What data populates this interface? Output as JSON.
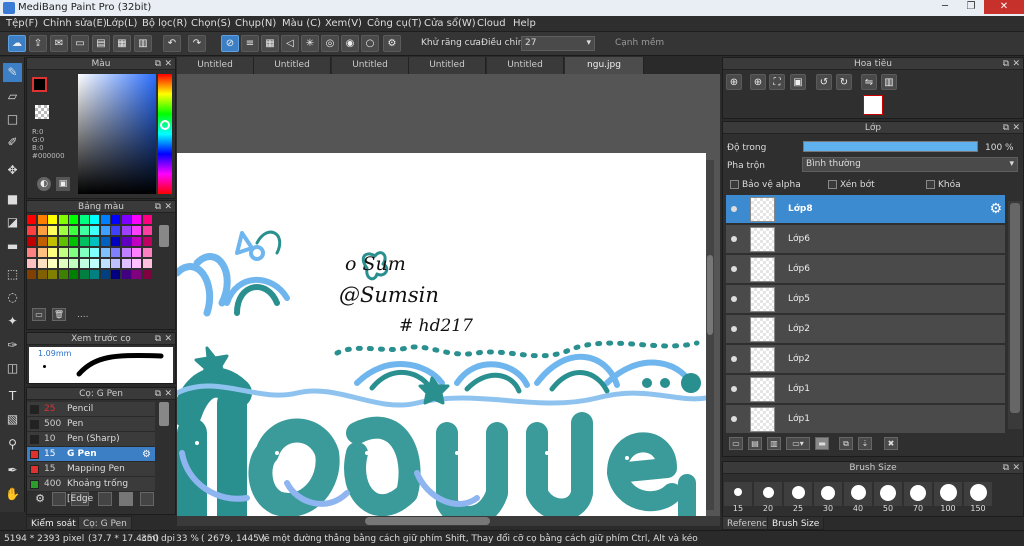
{
  "window": {
    "title": "MediBang Paint Pro (32bit)",
    "controls": [
      "─",
      "❐",
      "✕"
    ]
  },
  "menu": [
    "Tệp(F)",
    "Chỉnh sửa(E)",
    "Lớp(L)",
    "Bộ lọc(R)",
    "Chọn(S)",
    "Chụp(N)",
    "Màu (C)",
    "Xem(V)",
    "Công cụ(T)",
    "Cửa sổ(W)",
    "Cloud",
    "Help"
  ],
  "toolbar": {
    "antialias_label": "Khử răng cưa",
    "correction_label": "Điều chỉnh",
    "correction_value": "27",
    "snap_label": "Cạnh mềm"
  },
  "color_panel": {
    "title": "Màu",
    "r": "R:0",
    "g": "G:0",
    "b": "B:0",
    "hex": "#000000"
  },
  "palette_panel": {
    "title": "Bảng màu",
    "more": "....",
    "colors": [
      "#ff0000",
      "#ff8000",
      "#ffff00",
      "#80ff00",
      "#00ff00",
      "#00ff80",
      "#00ffff",
      "#0080ff",
      "#0000ff",
      "#8000ff",
      "#ff00ff",
      "#ff0080",
      "#ff4040",
      "#ffa040",
      "#ffff60",
      "#a0ff40",
      "#40ff40",
      "#40ffa0",
      "#40ffff",
      "#40a0ff",
      "#4040ff",
      "#a040ff",
      "#ff40ff",
      "#ff40a0",
      "#c00000",
      "#c06000",
      "#c0c000",
      "#60c000",
      "#00c000",
      "#00c060",
      "#00c0c0",
      "#0060c0",
      "#0000c0",
      "#6000c0",
      "#c000c0",
      "#c00060",
      "#ff8080",
      "#ffc080",
      "#ffff80",
      "#c0ff80",
      "#80ff80",
      "#80ffc0",
      "#80ffff",
      "#80c0ff",
      "#8080ff",
      "#c080ff",
      "#ff80ff",
      "#ff80c0",
      "#ffc0c0",
      "#ffe0c0",
      "#ffffc0",
      "#e0ffc0",
      "#c0ffc0",
      "#c0ffe0",
      "#c0ffff",
      "#c0e0ff",
      "#c0c0ff",
      "#e0c0ff",
      "#ffc0ff",
      "#ffc0e0",
      "#804000",
      "#806000",
      "#808000",
      "#408000",
      "#008000",
      "#008040",
      "#008080",
      "#004080",
      "#000080",
      "#400080",
      "#800080",
      "#800040"
    ]
  },
  "brush_preview": {
    "title": "Xem trước cọ",
    "size": "1.09mm"
  },
  "brush_panel": {
    "title": "Cọ: G Pen",
    "items": [
      {
        "size": "25",
        "name": "Pencil",
        "color": "#222222"
      },
      {
        "size": "500",
        "name": "Pen",
        "color": "#222222"
      },
      {
        "size": "10",
        "name": "Pen (Sharp)",
        "color": "#222222"
      },
      {
        "size": "15",
        "name": "G Pen",
        "color": "#e03030"
      },
      {
        "size": "15",
        "name": "Mapping Pen",
        "color": "#e03030"
      },
      {
        "size": "400",
        "name": "Khoảng trống [Edge",
        "color": "#2a9d2a"
      }
    ]
  },
  "bottom_tabs_left": [
    "Kiểm soát cọ",
    "Cọ: G Pen"
  ],
  "doc_tabs": [
    "Untitled",
    "Untitled",
    "Untitled",
    "Untitled",
    "Untitled",
    "ngu.jpg"
  ],
  "navigator": {
    "title": "Hoa tiêu"
  },
  "layer_panel": {
    "title": "Lớp",
    "opacity_label": "Độ trong",
    "opacity_value": "100 %",
    "blend_label": "Pha trộn",
    "blend_value": "Bình thường",
    "protect_alpha": "Bảo vệ alpha",
    "clipping": "Xén bớt",
    "lock": "Khóa",
    "layers": [
      "Lớp8",
      "Lớp6",
      "Lớp6",
      "Lớp5",
      "Lớp2",
      "Lớp2",
      "Lớp1",
      "Lớp1"
    ]
  },
  "brush_size_panel": {
    "title": "Brush Size",
    "sizes": [
      "15",
      "20",
      "25",
      "30",
      "40",
      "50",
      "70",
      "100",
      "150"
    ]
  },
  "bottom_tabs_right": [
    "Reference",
    "Brush Size"
  ],
  "artwork_text": {
    "line1": "o Sum",
    "line2": "@Sumsin",
    "line3": "# hd217",
    "big": "Nguyen"
  },
  "status": {
    "size": "5194 * 2393 pixel",
    "cm": "(37.7 * 17.4cm)",
    "dpi": "350 dpi",
    "zoom": "33 %",
    "coords": "( 2679, 1445 )",
    "hint": "Vẽ một đường thẳng bằng cách giữ phím Shift, Thay đổi cỡ cọ bằng cách giữ phím Ctrl, Alt và kéo"
  }
}
